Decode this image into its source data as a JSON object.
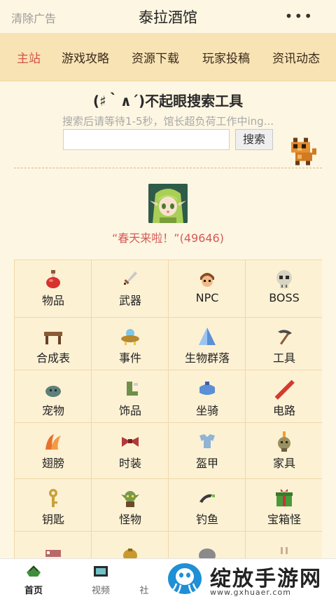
{
  "topbar": {
    "left_label": "清除广告",
    "title": "泰拉酒馆",
    "more_label": "•••"
  },
  "nav": {
    "tabs": [
      "主站",
      "游戏攻略",
      "资源下载",
      "玩家投稿",
      "资讯动态"
    ],
    "active": "主站"
  },
  "search": {
    "title": "(♯｀∧´)不起眼搜索工具",
    "subtitle": "搜索后请等待1-5秒，馆长超负荷工作中ing...",
    "input_value": "",
    "button_label": "搜索"
  },
  "greeting": "“春天来啦！”(49646)",
  "categories": [
    "物品",
    "武器",
    "NPC",
    "BOSS",
    "合成表",
    "事件",
    "生物群落",
    "工具",
    "宠物",
    "饰品",
    "坐骑",
    "电路",
    "翅膀",
    "时装",
    "盔甲",
    "家具",
    "钥匙",
    "怪物",
    "钓鱼",
    "宝箱怪"
  ],
  "bottom_tabs": [
    {
      "label": "首页",
      "active": true
    },
    {
      "label": "视频",
      "active": false
    },
    {
      "label": "社",
      "active": false
    }
  ],
  "watermark": {
    "text": "绽放手游网",
    "url": "www.gxhuaer.com"
  },
  "colors": {
    "accent": "#d4554a",
    "nav_bg": "#f8e3b4",
    "page_bg": "#fdf6e2"
  }
}
